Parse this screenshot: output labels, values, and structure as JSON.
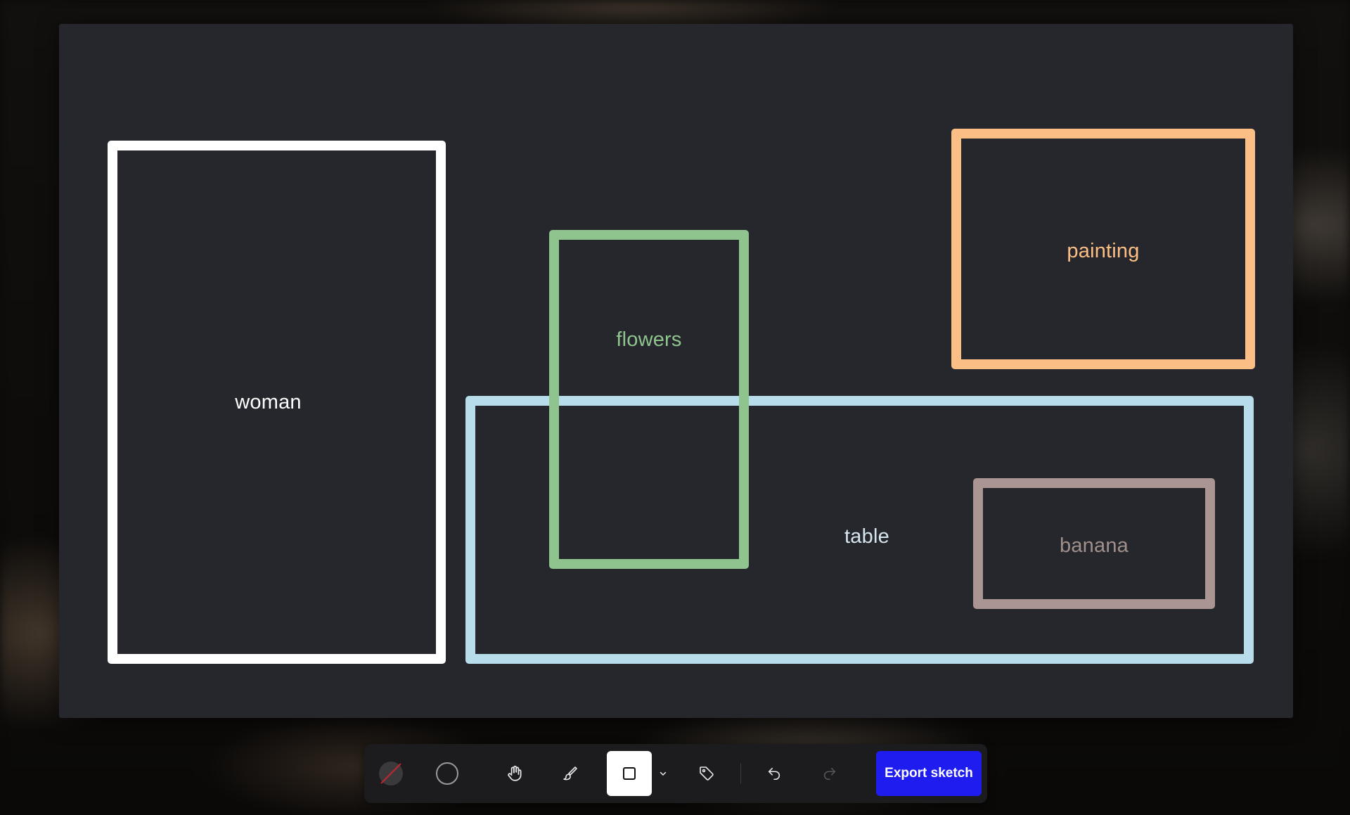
{
  "annotations": [
    {
      "label": "woman",
      "color": "#ffffff",
      "label_color": "#ffffff"
    },
    {
      "label": "flowers",
      "color": "#8fc48f",
      "label_color": "#8fc48f"
    },
    {
      "label": "painting",
      "color": "#fbbf85",
      "label_color": "#fbbf85"
    },
    {
      "label": "table",
      "color": "#b7dcea",
      "label_color": "#d6e6ee"
    },
    {
      "label": "banana",
      "color": "#ab9592",
      "label_color": "#a0908c"
    }
  ],
  "toolbar": {
    "icons": {
      "color_swatch": "no-color-swatch-icon",
      "circle": "circle-icon",
      "hand": "hand-pan-icon",
      "brush": "brush-icon",
      "rectangle": "rectangle-icon",
      "dropdown": "chevron-down-icon",
      "tag": "tag-icon",
      "undo": "undo-icon",
      "redo": "redo-icon"
    },
    "export_label": "Export sketch",
    "colors": {
      "accent": "#1f1cf0",
      "canvas": "#25272c",
      "toolbar": "#1c1c1e"
    }
  }
}
